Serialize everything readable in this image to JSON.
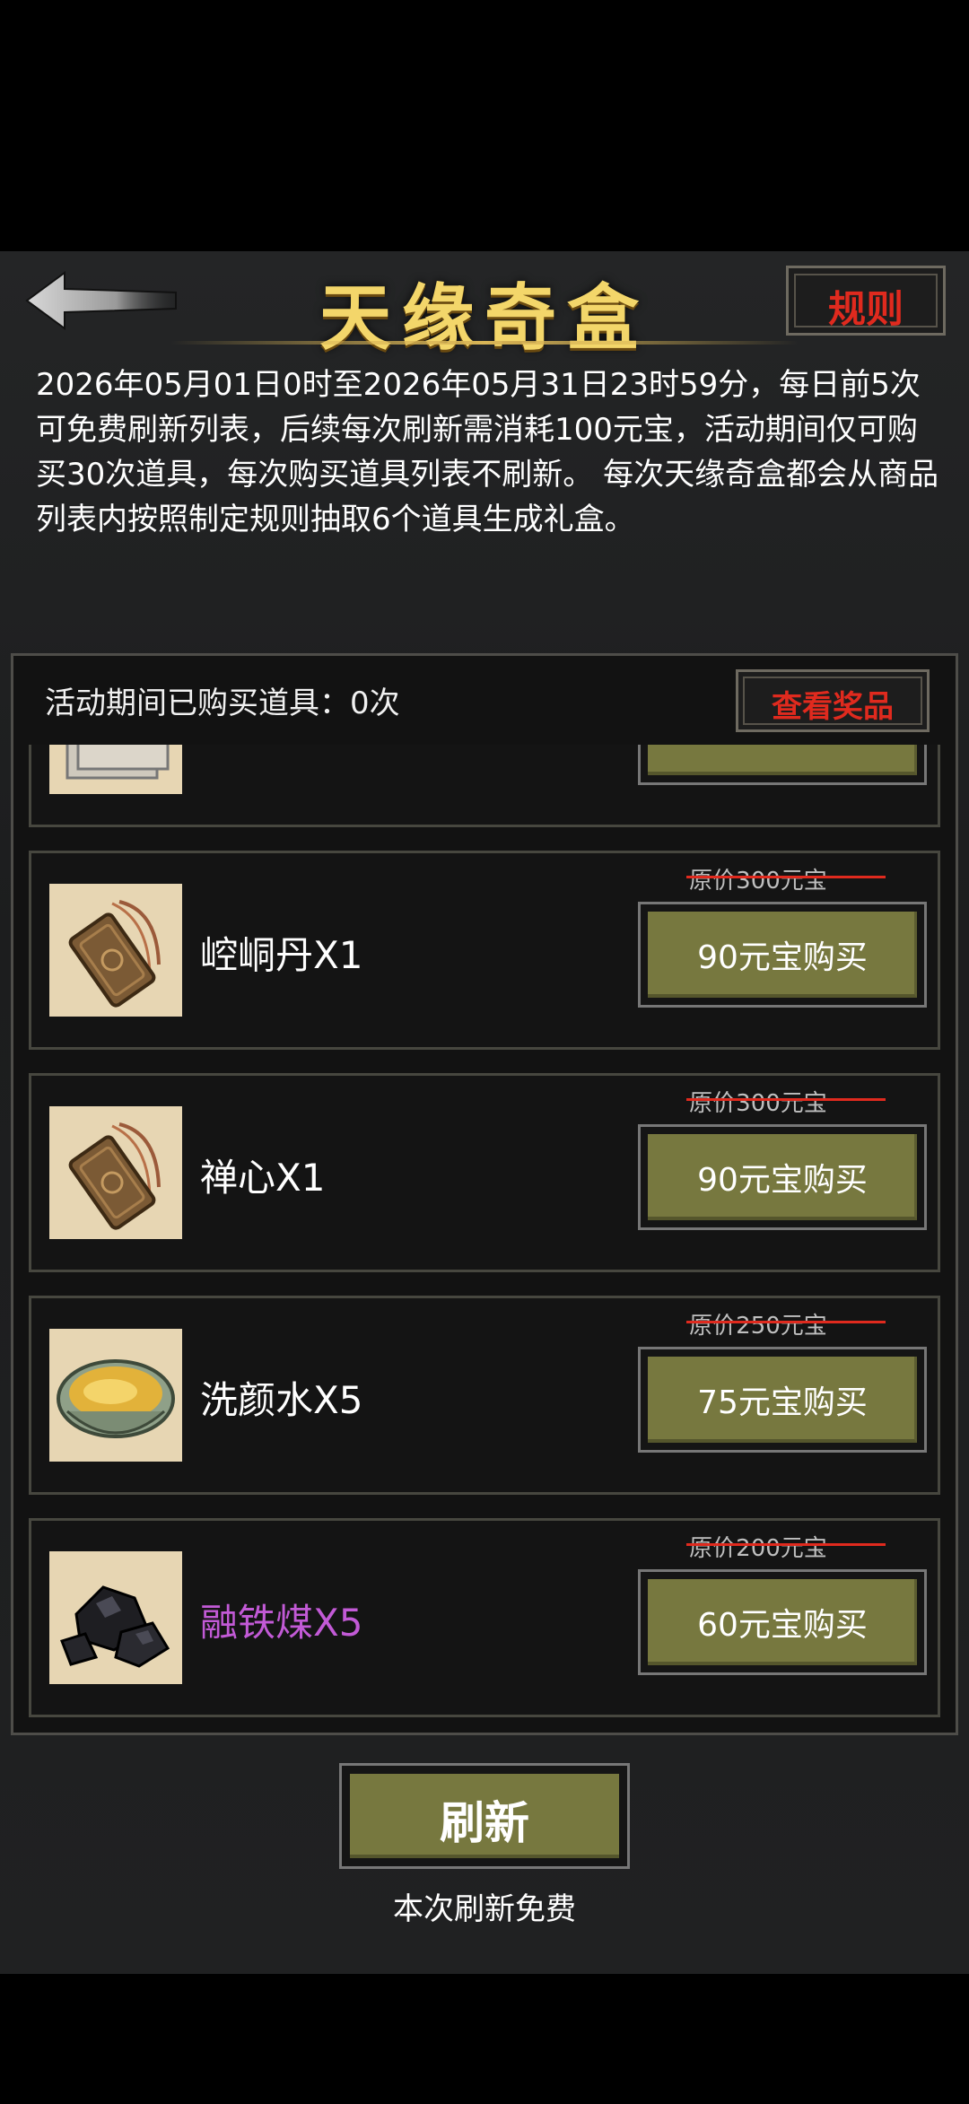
{
  "header": {
    "title": "天缘奇盒",
    "rule_label": "规则"
  },
  "description": "2026年05月01日0时至2026年05月31日23时59分，每日前5次可免费刷新列表，后续每次刷新需消耗100元宝，活动期间仅可购买30次道具，每次购买道具列表不刷新。 每次天缘奇盒都会从商品列表内按照制定规则抽取6个道具生成礼盒。",
  "purchase_count_label": "活动期间已购买道具：0次",
  "view_prizes_label": "查看奖品",
  "items": [
    {
      "name": "崆峒丹X1",
      "original_price": "原价300元宝",
      "buy_label": "90元宝购买",
      "icon": "token-icon",
      "name_color": "#ffffff"
    },
    {
      "name": "禅心X1",
      "original_price": "原价300元宝",
      "buy_label": "90元宝购买",
      "icon": "token-icon",
      "name_color": "#ffffff"
    },
    {
      "name": "洗颜水X5",
      "original_price": "原价250元宝",
      "buy_label": "75元宝购买",
      "icon": "bowl-icon",
      "name_color": "#ffffff"
    },
    {
      "name": "融铁煤X5",
      "original_price": "原价200元宝",
      "buy_label": "60元宝购买",
      "icon": "coal-icon",
      "name_color": "#c25ad6"
    }
  ],
  "refresh": {
    "label": "刷新",
    "note": "本次刷新免费"
  },
  "colors": {
    "title_gold": "#f3d66a",
    "accent_red": "#e02a1e",
    "button_olive": "#77783f",
    "rare_purple": "#c25ad6"
  }
}
